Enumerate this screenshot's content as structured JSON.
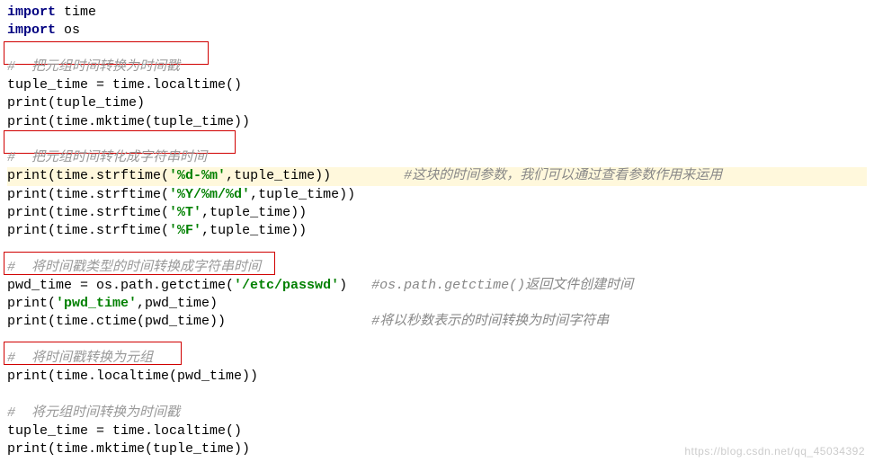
{
  "code": {
    "l1_import": "import",
    "l1_mod": " time",
    "l2_import": "import",
    "l2_mod": " os",
    "c1": "#  把元组时间转换为时间戳",
    "l3": "tuple_time = time.localtime()",
    "l4a": "print",
    "l4b": "(tuple_time)",
    "l5a": "print",
    "l5b": "(time.mktime(tuple_time))",
    "c2": "#  把元组时间转化成字符串时间",
    "l6a": "print",
    "l6b": "(time.strftime(",
    "l6s": "'%d-%m'",
    "l6c": ",tuple_time))",
    "c6": "#这块的时间参数，我们可以通过查看参数作用来运用",
    "l7a": "print",
    "l7b": "(time.strftime(",
    "l7s": "'%Y/%m/%d'",
    "l7c": ",tuple_time))",
    "l8a": "print",
    "l8b": "(time.strftime(",
    "l8s": "'%T'",
    "l8c": ",tuple_time))",
    "l9a": "print",
    "l9b": "(time.strftime(",
    "l9s": "'%F'",
    "l9c": ",tuple_time))",
    "c3": "#  将时间戳类型的时间转换成字符串时间",
    "l10a": "pwd_time = os.path.getctime(",
    "l10s": "'/etc/passwd'",
    "l10b": ")",
    "c10": "#os.path.getctime()返回文件创建时间",
    "l11a": "print",
    "l11b": "(",
    "l11s": "'pwd_time'",
    "l11c": ",pwd_time)",
    "l12a": "print",
    "l12b": "(time.ctime(pwd_time))",
    "c12": "#将以秒数表示的时间转换为时间字符串",
    "c4": "#  将时间戳转换为元组",
    "l13a": "print",
    "l13b": "(time.localtime(pwd_time))",
    "c5": "#  将元组时间转换为时间戳",
    "l14": "tuple_time = time.localtime()",
    "l15a": "print",
    "l15b": "(time.mktime(tuple_time))"
  },
  "watermark": "https://blog.csdn.net/qq_45034392"
}
